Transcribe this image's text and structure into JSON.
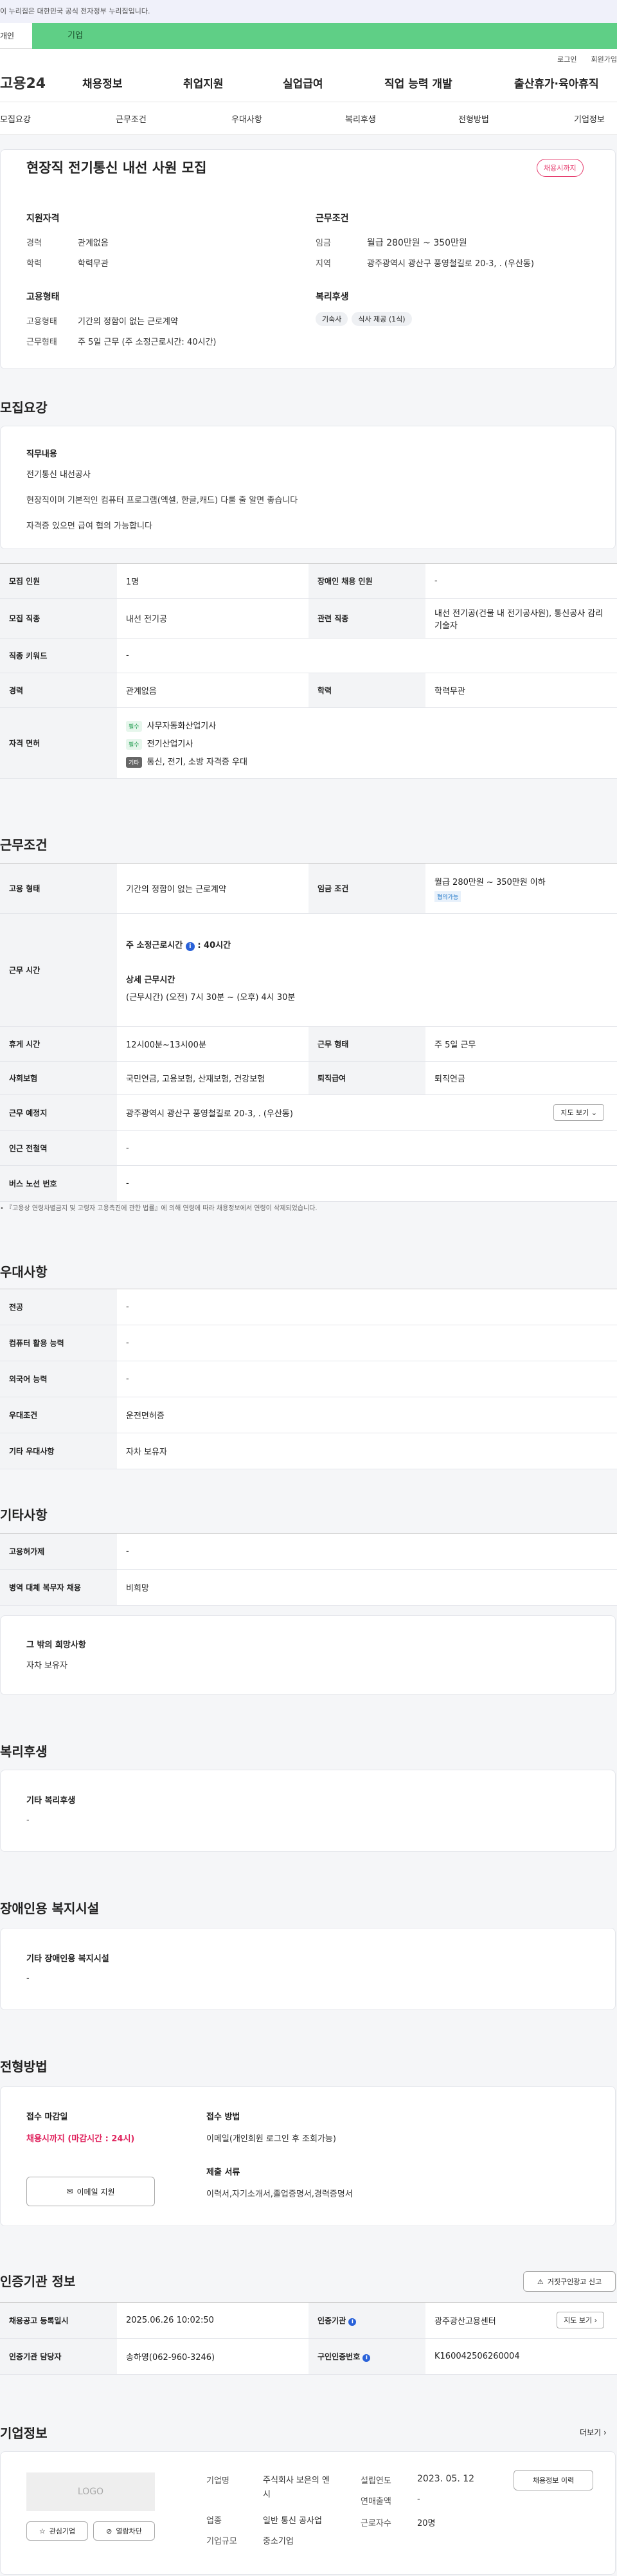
{
  "top": {
    "notice": "이 누리집은 대한민국 공식 전자정부 누리집입니다.",
    "mode_personal": "개인",
    "mode_company": "기업",
    "login": "로그인",
    "join": "회원가입"
  },
  "gnb": {
    "logo": "고용24",
    "items": [
      "채용정보",
      "취업지원",
      "실업급여",
      "직업 능력 개발",
      "출산휴가·육아휴직"
    ]
  },
  "tabs": [
    "모집요강",
    "근무조건",
    "우대사항",
    "복리후생",
    "전형방법",
    "기업정보"
  ],
  "job": {
    "title": "현장직 전기통신 내선 사원 모집",
    "status": "채용시까지",
    "qual_title": "지원자격",
    "exp_label": "경력",
    "exp": "관계없음",
    "edu_label": "학력",
    "edu": "학력무관",
    "cond_title": "근무조건",
    "wage_label": "임금",
    "wage": "월급 280만원 ~ 350만원",
    "area_label": "지역",
    "area": "광주광역시 광산구 풍영철길로 20-3, . (우산동)",
    "emp_title": "고용형태",
    "emp_type_label": "고용형태",
    "emp_type": "기간의 정함이 없는 근로계약",
    "work_type_label": "근무형태",
    "work_type": "주 5일 근무 (주 소정근로시간: 40시간)",
    "welfare_title": "복리후생",
    "welfare": [
      "기숙사",
      "식사 제공 (1식)"
    ]
  },
  "recruit": {
    "section": "모집요강",
    "duty_title": "직무내용",
    "duty_lines": [
      "전기통신 내선공사",
      "현장직이며 기본적인 컴퓨터 프로그램(엑셀, 한글,캐드) 다룰 줄 알면 좋습니다",
      "자격증 있으면 급여 협의 가능합니다"
    ],
    "rows": {
      "r1": [
        "모집 인원",
        "1명",
        "장애인 채용 인원",
        "-"
      ],
      "r2": [
        "모집 직종",
        "내선 전기공",
        "관련 직종",
        "내선 전기공(건물 내 전기공사원), 통신공사 감리 기술자"
      ],
      "r3": [
        "직종 키워드",
        "-"
      ],
      "r4": [
        "경력",
        "관계없음",
        "학력",
        "학력무관"
      ],
      "license_label": "자격 면허",
      "licenses": [
        {
          "tag": "필수",
          "name": "사무자동화산업기사"
        },
        {
          "tag": "필수",
          "name": "전기산업기사"
        },
        {
          "tag": "기타",
          "name": "통신, 전기, 소방 자격증 우대"
        }
      ]
    }
  },
  "work": {
    "section": "근무조건",
    "emp_label": "고용 형태",
    "emp": "기간의 정함이 없는 근로계약",
    "wage_label": "임금 조건",
    "wage": "월급 280만원 ~ 350만원 이하",
    "wage_tag": "협의가능",
    "hours_label": "근무 시간",
    "weekly": "주 소정근로시간",
    "weekly_val": ": 40시간",
    "detail_title": "상세 근무시간",
    "detail": "(근무시간) (오전) 7시 30분 ~ (오후) 4시 30분",
    "rest_label": "휴게 시간",
    "rest": "12시00분~13시00분",
    "form_label": "근무 형태",
    "form": "주 5일 근무",
    "ins_label": "사회보험",
    "ins": "국민연금, 고용보험, 산재보험, 건강보험",
    "ret_label": "퇴직급여",
    "ret": "퇴직연금",
    "place_label": "근무 예정지",
    "place": "광주광역시 광산구 풍영철길로 20-3, . (우산동)",
    "map_btn": "지도 보기",
    "subway_label": "인근 전철역",
    "subway": "-",
    "bus_label": "버스 노선 번호",
    "bus": "-",
    "note": "『고용상 연령차별금지 및 고령자 고용촉진에 관한 법률』에 의해 연령에 따라 채용정보에서 연령이 삭제되었습니다."
  },
  "pref": {
    "section": "우대사항",
    "rows": [
      [
        "전공",
        "-"
      ],
      [
        "컴퓨터 활용 능력",
        "-"
      ],
      [
        "외국어 능력",
        "-"
      ],
      [
        "우대조건",
        "운전면허증"
      ],
      [
        "기타 우대사항",
        "자차 보유자"
      ]
    ]
  },
  "etc": {
    "section": "기타사항",
    "rows": [
      [
        "고용허가제",
        "-"
      ],
      [
        "병역 대체 복무자 채용",
        "비희망"
      ]
    ],
    "wish_title": "그 밖의 희망사항",
    "wish": "자차 보유자"
  },
  "benefit": {
    "section": "복리후생",
    "title": "기타 복리후생",
    "value": "-"
  },
  "disab": {
    "section": "장애인용 복지시설",
    "title": "기타 장애인용 복지시설",
    "value": "-"
  },
  "process": {
    "section": "전형방법",
    "deadline_title": "접수 마감일",
    "deadline": "채용시까지 (마감시간 : 24시)",
    "email_btn": "이메일 지원",
    "method_title": "접수 방법",
    "method": "이메일(개인회원 로그인 후 조회가능)",
    "docs_title": "제출 서류",
    "docs": "이력서,자기소개서,졸업증명서,경력증명서"
  },
  "agency": {
    "section": "인증기관 정보",
    "report_btn": "거짓구인광고 신고",
    "r1": [
      "채용공고 등록일시",
      "2025.06.26 10:02:50",
      "인증기관",
      "광주광산고용센터"
    ],
    "map_btn": "지도 보기",
    "r2": [
      "인증기관 담당자",
      "송하영(062-960-3246)",
      "구인인증번호",
      "K160042506260004"
    ]
  },
  "company": {
    "section": "기업정보",
    "more": "더보기",
    "logo": "LOGO",
    "fav": "관심기업",
    "block": "열람차단",
    "name_label": "기업명",
    "name": "주식회사 보은의 엔시",
    "ind_label": "업종",
    "ind": "일반 통신 공사업",
    "size_label": "기업규모",
    "size": "중소기업",
    "est_label": "설립연도",
    "est": "2023. 05. 12",
    "sales_label": "연매출액",
    "sales": "-",
    "staff_label": "근로자수",
    "staff": "20명",
    "jobs_btn": "채용정보 이력"
  }
}
